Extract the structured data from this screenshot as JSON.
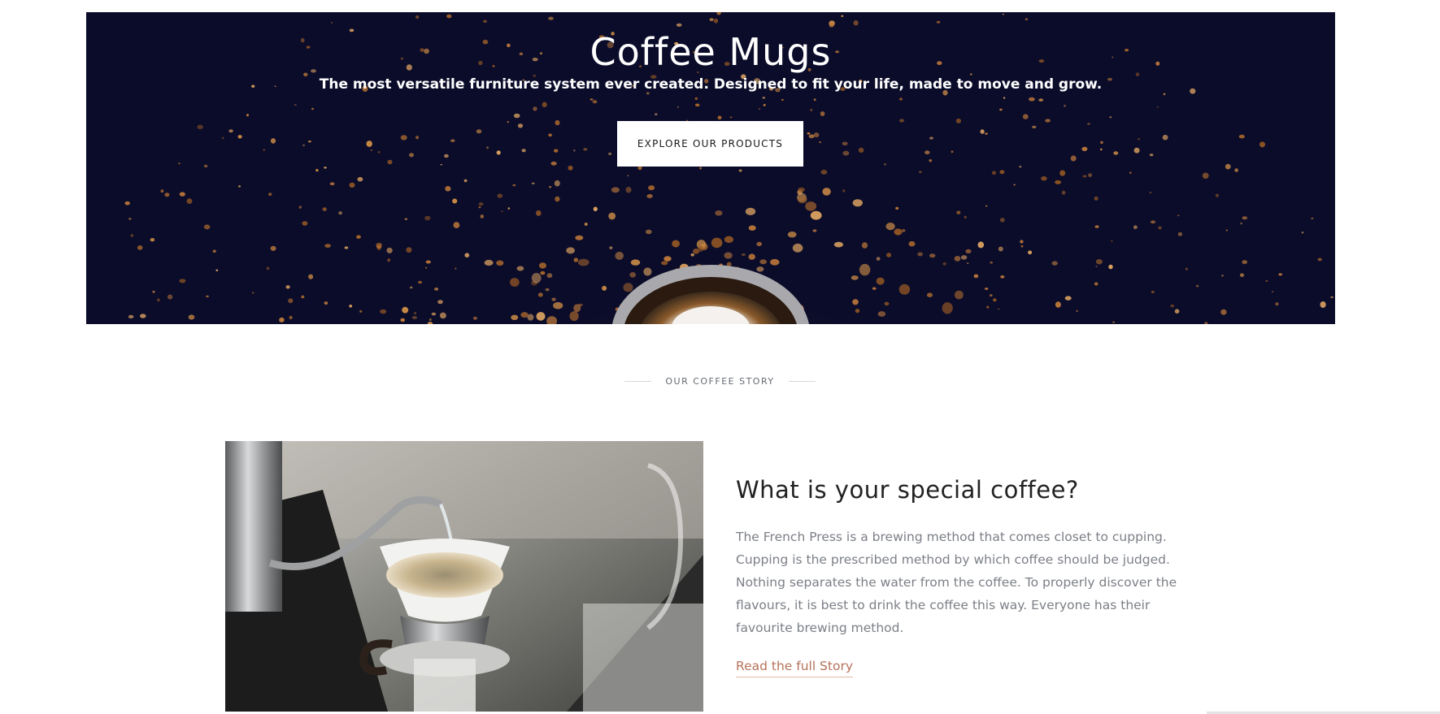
{
  "hero": {
    "title": "Coffee Mugs",
    "subtitle": "The most versatile furniture system ever created. Designed to fit your life, made to move and grow.",
    "cta_label": "EXPLORE OUR PRODUCTS",
    "background_color": "#0b0c2a",
    "accent_color": "#b8753a"
  },
  "section": {
    "heading": "OUR COFFEE STORY"
  },
  "story": {
    "title": "What is your special coffee?",
    "body": "The French Press is a brewing method that comes closet to cupping. Cupping is the prescribed method by which coffee should be judged. Nothing separates the water from the coffee. To properly discover the flavours, it is best to drink the coffee this way. Everyone has their favourite brewing method.",
    "link_label": "Read the full Story",
    "link_color": "#b5735a"
  }
}
